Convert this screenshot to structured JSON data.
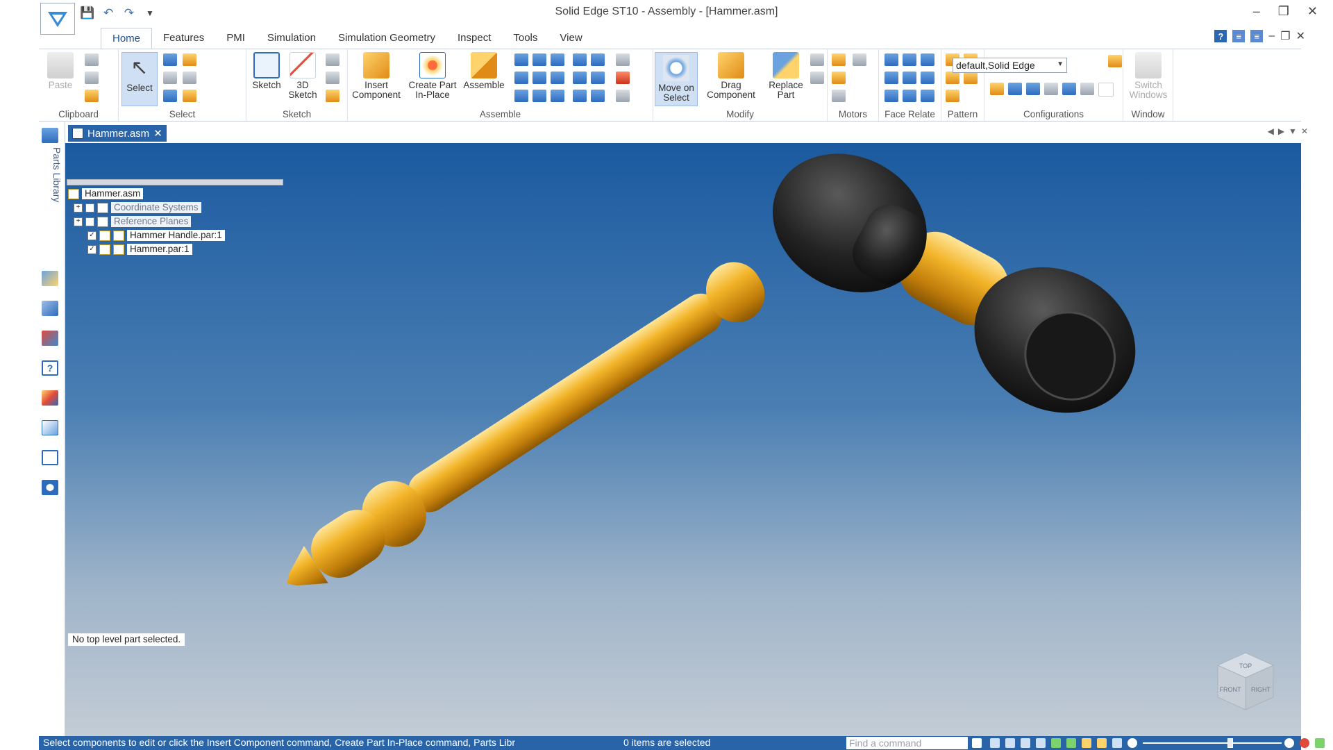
{
  "window": {
    "title": "Solid Edge ST10 - Assembly - [Hammer.asm]"
  },
  "tabs": [
    "Home",
    "Features",
    "PMI",
    "Simulation",
    "Simulation Geometry",
    "Inspect",
    "Tools",
    "View"
  ],
  "ribbon": {
    "clipboard": {
      "paste": "Paste",
      "group": "Clipboard"
    },
    "select": {
      "select": "Select",
      "group": "Select"
    },
    "sketch": {
      "sketch": "Sketch",
      "sketch3d_1": "3D",
      "sketch3d_2": "Sketch",
      "group": "Sketch"
    },
    "assemble": {
      "insert_1": "Insert",
      "insert_2": "Component",
      "create_1": "Create Part",
      "create_2": "In-Place",
      "assemble": "Assemble",
      "group": "Assemble"
    },
    "modify": {
      "move_1": "Move on",
      "move_2": "Select",
      "drag_1": "Drag",
      "drag_2": "Component",
      "replace_1": "Replace",
      "replace_2": "Part",
      "group": "Modify"
    },
    "motors": {
      "group": "Motors"
    },
    "face_relate": {
      "group": "Face Relate"
    },
    "pattern": {
      "group": "Pattern"
    },
    "configurations": {
      "value": "default,Solid Edge",
      "group": "Configurations"
    },
    "window": {
      "switch_1": "Switch",
      "switch_2": "Windows",
      "group": "Window"
    }
  },
  "sidebar": {
    "parts_library": "Parts Library"
  },
  "document_tab": {
    "label": "Hammer.asm"
  },
  "tree": {
    "root": "Hammer.asm",
    "items": [
      {
        "label": "Coordinate Systems",
        "checked": false
      },
      {
        "label": "Reference Planes",
        "checked": false
      },
      {
        "label": "Hammer Handle.par:1",
        "checked": true
      },
      {
        "label": "Hammer.par:1",
        "checked": true
      }
    ]
  },
  "viewport": {
    "message": "No top level part selected."
  },
  "view_cube": {
    "top": "TOP",
    "front": "FRONT",
    "right": "RIGHT"
  },
  "statusbar": {
    "prompt": "Select components to edit or click the Insert Component command, Create Part In-Place command, Parts Libr",
    "selection_count": "0 items are selected",
    "find_placeholder": "Find a command"
  },
  "colors": {
    "accent": "#2a64a8",
    "handle_gold": "#e3a51c",
    "head_black": "#1f1f1f"
  }
}
